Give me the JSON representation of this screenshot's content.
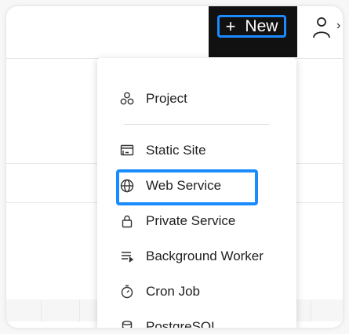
{
  "header": {
    "new_button": {
      "label": "New",
      "plus": "+"
    },
    "user_icon": "person-icon"
  },
  "menu": {
    "items": [
      {
        "label": "Project",
        "icon": "project-icon"
      },
      {
        "label": "Static Site",
        "icon": "static-site-icon"
      },
      {
        "label": "Web Service",
        "icon": "globe-icon"
      },
      {
        "label": "Private Service",
        "icon": "lock-icon"
      },
      {
        "label": "Background Worker",
        "icon": "worker-icon"
      },
      {
        "label": "Cron Job",
        "icon": "stopwatch-icon"
      },
      {
        "label": "PostgreSQL",
        "icon": "database-icon"
      }
    ]
  },
  "colors": {
    "accent": "#1a8cff",
    "header_dark": "#111111"
  }
}
